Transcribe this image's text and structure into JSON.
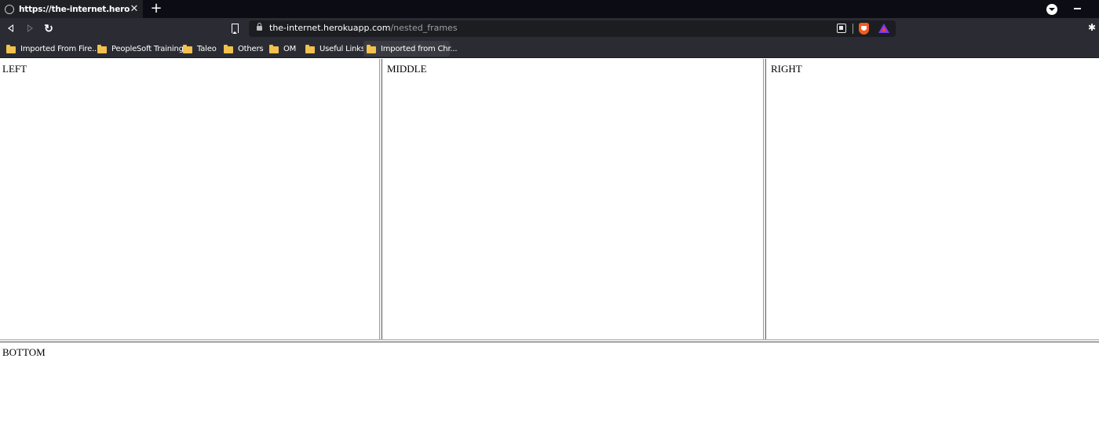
{
  "browser": {
    "tab": {
      "title": "https://the-internet.herokuapp.com/nested_frames",
      "close": "✕"
    },
    "new_tab": "+",
    "reload_glyph": "↻",
    "extensions_glyph": "✱",
    "address": {
      "host": "the-internet.herokuapp.com",
      "path": "/nested_frames"
    },
    "bookmarks": [
      {
        "label": "Imported From Fire..."
      },
      {
        "label": "PeopleSoft Training"
      },
      {
        "label": "Taleo"
      },
      {
        "label": "Others"
      },
      {
        "label": "OM"
      },
      {
        "label": "Useful Links"
      },
      {
        "label": "Imported from Chr..."
      }
    ]
  },
  "frames": {
    "left": "LEFT",
    "middle": "MIDDLE",
    "right": "RIGHT",
    "bottom": "BOTTOM"
  },
  "colors": {
    "tab_strip": "#0c0c14",
    "toolbar": "#2b2c33",
    "omnibox": "#1c1d21",
    "folder": "#f2c14e",
    "brave": "#f25b21"
  },
  "icons": [
    "globe-icon",
    "close-icon",
    "plus-icon",
    "tab-search-icon",
    "minimize-icon",
    "back-icon",
    "forward-icon",
    "reload-icon",
    "bookmark-icon",
    "lock-icon",
    "qr-code-icon",
    "brave-shields-icon",
    "brave-rewards-icon",
    "extensions-icon",
    "folder-icon"
  ]
}
